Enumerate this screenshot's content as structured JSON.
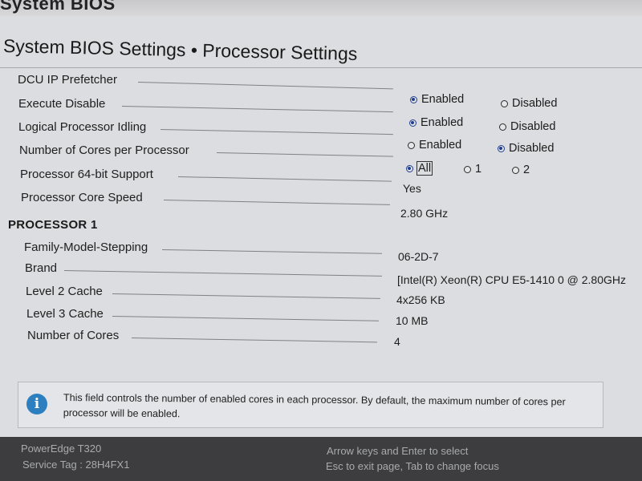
{
  "window": {
    "title": "System BIOS"
  },
  "page": {
    "title": "System BIOS Settings • Processor Settings"
  },
  "settings": [
    {
      "label": "DCU IP Prefetcher"
    },
    {
      "label": "Execute Disable",
      "options": [
        "Enabled",
        "Disabled"
      ],
      "selected": "Enabled"
    },
    {
      "label": "Logical Processor Idling",
      "options": [
        "Enabled",
        "Disabled"
      ],
      "selected": "Enabled"
    },
    {
      "label": "Number of Cores per Processor",
      "options": [
        "Enabled",
        "Disabled"
      ],
      "selected": "Disabled"
    },
    {
      "label": "Processor 64-bit Support",
      "options": [
        "All",
        "1",
        "2"
      ],
      "selected": "All"
    },
    {
      "label": "Processor Core Speed",
      "value": "Yes"
    },
    {
      "label": "",
      "value": "2.80 GHz"
    }
  ],
  "processor1": {
    "header": "PROCESSOR 1",
    "rows": [
      {
        "label": "Family-Model-Stepping",
        "value": "06-2D-7"
      },
      {
        "label": "Brand",
        "value": "[Intel(R) Xeon(R) CPU E5-1410 0 @ 2.80GHz"
      },
      {
        "label": "Level 2 Cache",
        "value": "4x256 KB"
      },
      {
        "label": "Level 3 Cache",
        "value": "10 MB"
      },
      {
        "label": "Number of Cores",
        "value": "4"
      }
    ]
  },
  "help": {
    "icon": "info-icon",
    "text": "This field controls the number of enabled cores in each processor. By default, the maximum number of cores per processor will be enabled."
  },
  "footer": {
    "model": "PowerEdge T320",
    "service_tag": "Service Tag : 28H4FX1",
    "hint_nav": "Arrow keys and Enter to select",
    "hint_exit": "Esc to exit page, Tab to change focus"
  },
  "colors": {
    "radio_selected": "#1f3d8f",
    "info_icon": "#2e7fc0",
    "footer_bg": "#3d3d40"
  }
}
